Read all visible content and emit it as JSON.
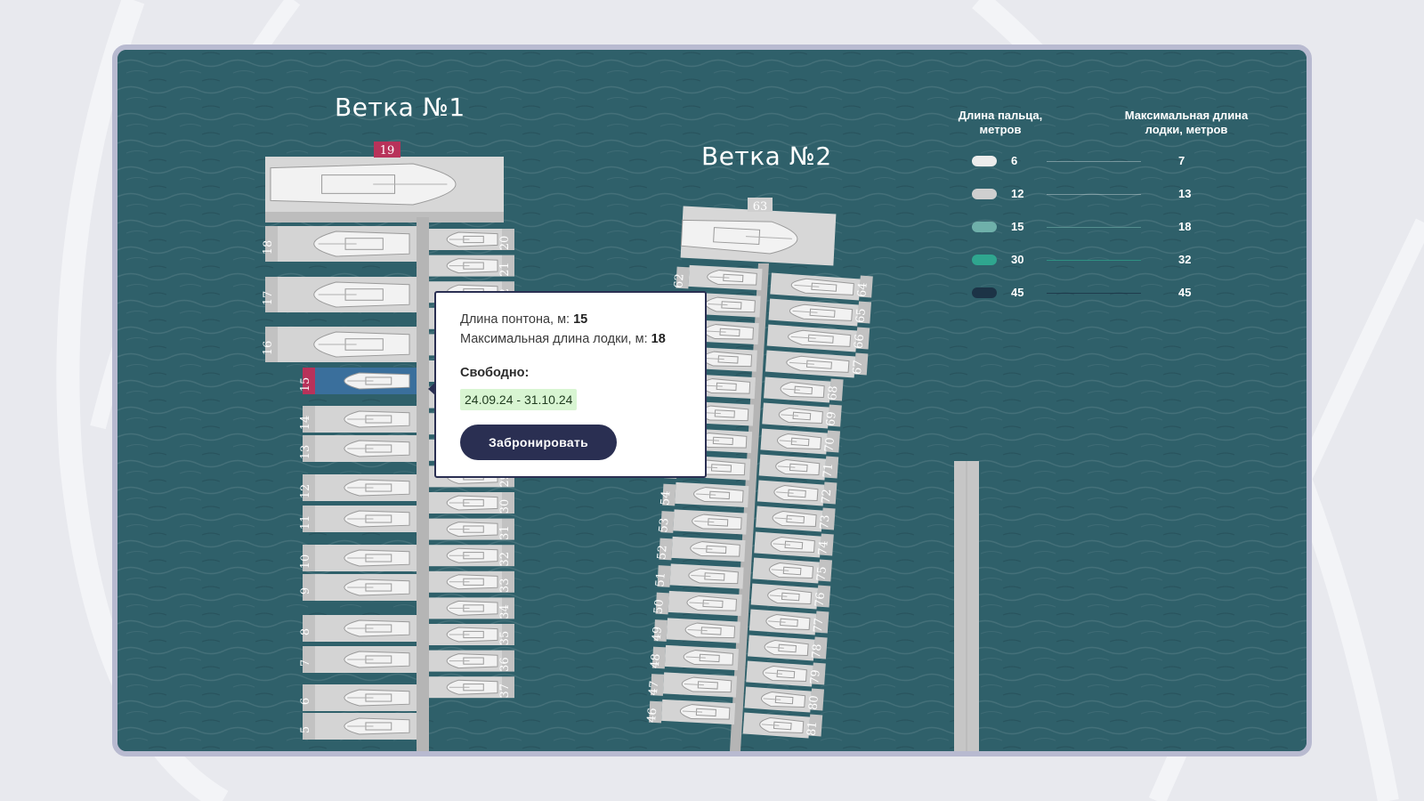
{
  "branches": [
    {
      "title": "Ветка №1"
    },
    {
      "title": "Ветка №2"
    }
  ],
  "legend": {
    "finger_header": "Длина пальца, метров",
    "boat_header": "Максимальная длина лодки, метров",
    "rows": [
      {
        "finger": "6",
        "boat": "7",
        "color": "#ececec"
      },
      {
        "finger": "12",
        "boat": "13",
        "color": "#cfcfcf"
      },
      {
        "finger": "15",
        "boat": "18",
        "color": "#6fb0aa"
      },
      {
        "finger": "30",
        "boat": "32",
        "color": "#2fa68f"
      },
      {
        "finger": "45",
        "boat": "45",
        "color": "#1c3346"
      }
    ]
  },
  "popup": {
    "pontoon_label": "Длина понтона, м:",
    "pontoon_value": "15",
    "boat_label": "Максимальная длина лодки, м:",
    "boat_value": "18",
    "free_label": "Свободно:",
    "date_range": "24.09.24 - 31.10.24",
    "book_button": "Забронировать"
  },
  "berths": {
    "branch1_top": "19",
    "branch1_left": [
      "18",
      "17",
      "16",
      "15",
      "14",
      "13",
      "12",
      "11",
      "10",
      "9",
      "8",
      "7",
      "6",
      "5"
    ],
    "branch1_right": [
      "20",
      "21",
      "22",
      "23",
      "24",
      "25",
      "26",
      "27",
      "28",
      "29",
      "30",
      "31",
      "32",
      "33",
      "34",
      "35",
      "36",
      "37"
    ],
    "branch2_top": "63",
    "branch2_left": [
      "62",
      "61",
      "60",
      "59",
      "58",
      "57",
      "56",
      "55",
      "54",
      "53",
      "52",
      "51",
      "50",
      "49",
      "48",
      "47",
      "46"
    ],
    "branch2_right": [
      "64",
      "65",
      "66",
      "67",
      "68",
      "69",
      "70",
      "71",
      "72",
      "73",
      "74",
      "75",
      "76",
      "77",
      "78",
      "79",
      "80",
      "81"
    ],
    "selected": "15"
  },
  "colors": {
    "water": "#2e5e68",
    "pier": "#c9c9c9",
    "selected_berth": "#3a6f9c",
    "berth_label": "#b8325a",
    "accent": "#2a2f52"
  }
}
